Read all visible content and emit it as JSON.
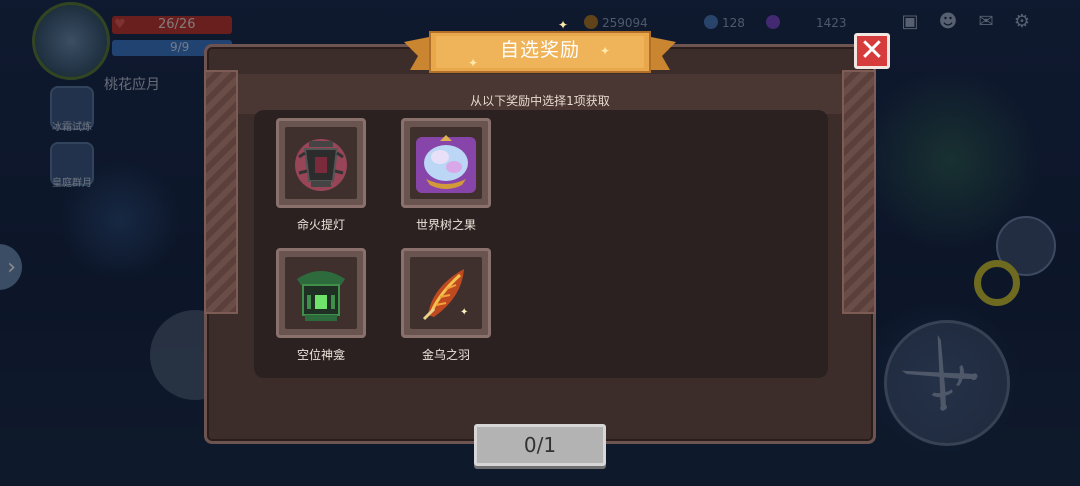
{
  "hud": {
    "hp_text": "26/26",
    "hp_fraction": 1.0,
    "mp_text": "9/9",
    "mp_fraction": 1.0,
    "player_name": "桃花应月",
    "left_menu": [
      {
        "label": "冰霜试炼",
        "icon": "snowflake-icon"
      },
      {
        "label": "皇庭群月",
        "icon": "trophy-icon"
      }
    ],
    "currencies": [
      "259094",
      "128",
      "1423"
    ],
    "top_icons": [
      "map-icon",
      "friends-icon",
      "mail-icon",
      "settings-icon"
    ]
  },
  "dialog": {
    "title": "自选奖励",
    "instruction": "从以下奖励中选择1项获取",
    "close_icon": "close-icon",
    "items": [
      {
        "name": "命火提灯",
        "icon": "lantern-icon",
        "glow": "#e0577a"
      },
      {
        "name": "世界树之果",
        "icon": "fruit-icon",
        "glow": "#a64ee0"
      },
      {
        "name": "空位神龛",
        "icon": "shrine-icon",
        "glow": "#3f8f4a"
      },
      {
        "name": "金乌之羽",
        "icon": "feather-icon",
        "glow": "#d9652b"
      }
    ],
    "counter": "0/1"
  },
  "colors": {
    "panel": "#3c2c2a",
    "banner": "#e9a74b",
    "close": "#d63c3c"
  }
}
